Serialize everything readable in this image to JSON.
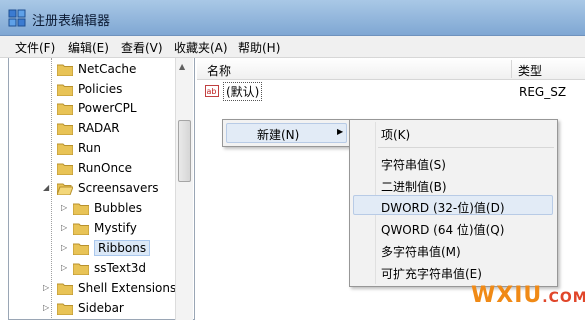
{
  "window": {
    "title": "注册表编辑器"
  },
  "menubar": {
    "items": [
      {
        "label": "文件(F)"
      },
      {
        "label": "编辑(E)"
      },
      {
        "label": "查看(V)"
      },
      {
        "label": "收藏夹(A)"
      },
      {
        "label": "帮助(H)"
      }
    ]
  },
  "tree": {
    "items": [
      {
        "label": "NetCache"
      },
      {
        "label": "Policies"
      },
      {
        "label": "PowerCPL"
      },
      {
        "label": "RADAR"
      },
      {
        "label": "Run"
      },
      {
        "label": "RunOnce"
      },
      {
        "label": "Screensavers",
        "expanded": true
      },
      {
        "label": "Bubbles"
      },
      {
        "label": "Mystify"
      },
      {
        "label": "Ribbons",
        "selected": true
      },
      {
        "label": "ssText3d"
      },
      {
        "label": "Shell Extensions"
      },
      {
        "label": "Sidebar"
      }
    ]
  },
  "list": {
    "columns": [
      "名称",
      "类型"
    ],
    "rows": [
      {
        "name": "(默认)",
        "type": "REG_SZ"
      }
    ]
  },
  "context_menu": {
    "new_label": "新建(N)"
  },
  "submenu": {
    "items": [
      {
        "label": "项(K)"
      },
      {
        "label": "字符串值(S)"
      },
      {
        "label": "二进制值(B)"
      },
      {
        "label": "DWORD (32-位)值(D)",
        "highlighted": true
      },
      {
        "label": "QWORD (64 位)值(Q)"
      },
      {
        "label": "多字符串值(M)"
      },
      {
        "label": "可扩充字符串值(E)"
      }
    ]
  },
  "watermark": {
    "main": "WXIU",
    "dot": ".",
    "suffix": "COM"
  },
  "colors": {
    "folder": "#e8c356",
    "highlight": "#e2ebf6",
    "watermark": "#f08a16"
  }
}
